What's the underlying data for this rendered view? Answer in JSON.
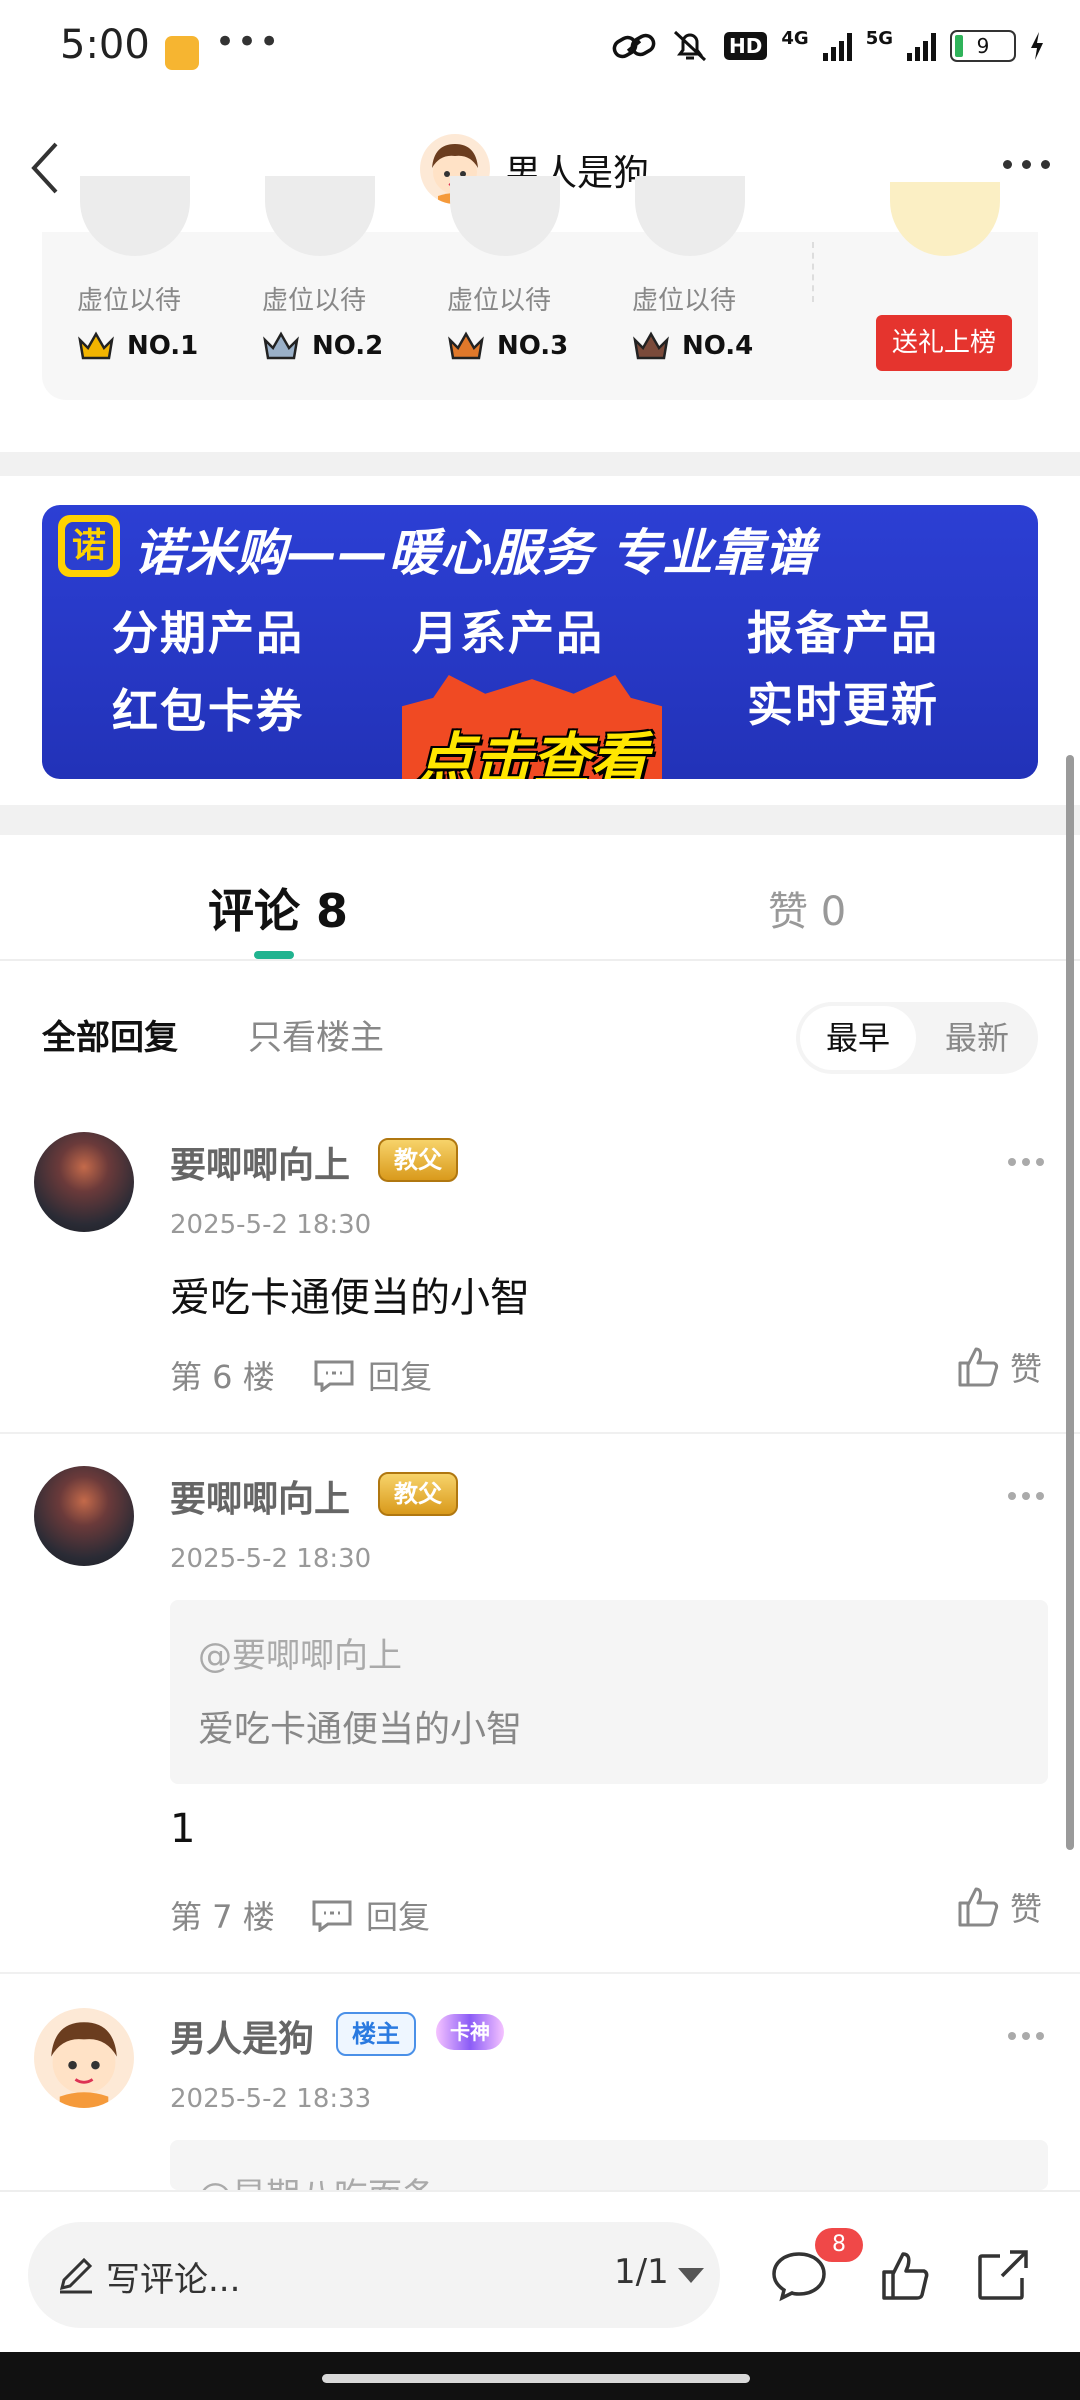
{
  "status_bar": {
    "time": "5:00",
    "dots": "•••",
    "hd": "HD",
    "net1": "4G",
    "net2": "5G",
    "battery": "9"
  },
  "header": {
    "title": "男人是狗"
  },
  "rank": {
    "items": [
      {
        "label": "虚位以待",
        "no": "NO.1",
        "color": "#f2b400"
      },
      {
        "label": "虚位以待",
        "no": "NO.2",
        "color": "#9ab0c8"
      },
      {
        "label": "虚位以待",
        "no": "NO.3",
        "color": "#e0782a"
      },
      {
        "label": "虚位以待",
        "no": "NO.4",
        "color": "#7a4a3a"
      }
    ],
    "gift_button": "送礼上榜"
  },
  "banner": {
    "logo": "诺",
    "headline": "诺米购——暖心服务 专业靠谱",
    "cells": [
      "分期产品",
      "月系产品",
      "报备产品",
      "红包卡券",
      "实时更新"
    ],
    "cta": "点击查看"
  },
  "tabs": {
    "comments": "评论 8",
    "likes": "赞 0"
  },
  "filter": {
    "all": "全部回复",
    "owner_only": "只看楼主",
    "earliest": "最早",
    "latest": "最新"
  },
  "comments": [
    {
      "name": "要唧唧向上",
      "badge": "教父",
      "time": "2025-5-2 18:30",
      "text": "爱吃卡通便当的小智",
      "floor": "第 6 楼",
      "reply": "回复",
      "like": "赞"
    },
    {
      "name": "要唧唧向上",
      "badge": "教父",
      "time": "2025-5-2 18:30",
      "quote_name": "@要唧唧向上",
      "quote_text": "爱吃卡通便当的小智",
      "text": "1",
      "floor": "第 7 楼",
      "reply": "回复",
      "like": "赞"
    },
    {
      "name": "男人是狗",
      "badge": "楼主",
      "badge2": "卡神",
      "time": "2025-5-2 18:33",
      "quote_name": "@星期八吃面条"
    }
  ],
  "bottom_bar": {
    "placeholder": "写评论...",
    "page": "1/1",
    "comment_count": "8"
  },
  "colors": {
    "accent": "#20b38f",
    "red": "#e5342e",
    "banner_blue": "#2c3fd4"
  }
}
